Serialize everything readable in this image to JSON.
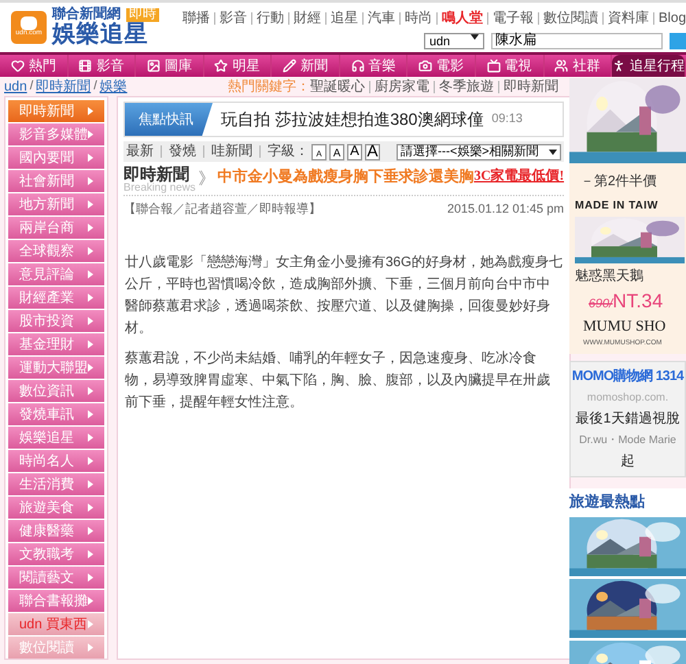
{
  "header": {
    "brand_small": "聯合新聞網",
    "brand_badge": "即時",
    "brand_name": "娛樂追星",
    "logo_caption": "udn.com",
    "top_links": [
      {
        "label": "聯播",
        "highlight": false
      },
      {
        "label": "影音",
        "highlight": false
      },
      {
        "label": "行動",
        "highlight": false
      },
      {
        "label": "財經",
        "highlight": false
      },
      {
        "label": "追星",
        "highlight": false
      },
      {
        "label": "汽車",
        "highlight": false
      },
      {
        "label": "時尚",
        "highlight": false
      },
      {
        "label": "鳴人堂",
        "highlight": true
      },
      {
        "label": "電子報",
        "highlight": false
      },
      {
        "label": "數位閱讀",
        "highlight": false
      },
      {
        "label": "資料庫",
        "highlight": false
      },
      {
        "label": "Blog",
        "highlight": false
      }
    ],
    "search": {
      "scope": "udn",
      "value": "陳水扁"
    }
  },
  "nav": [
    {
      "label": "熱門",
      "selected": false
    },
    {
      "label": "影音",
      "selected": false
    },
    {
      "label": "圖庫",
      "selected": false
    },
    {
      "label": "明星",
      "selected": false
    },
    {
      "label": "新聞",
      "selected": false
    },
    {
      "label": "音樂",
      "selected": false
    },
    {
      "label": "電影",
      "selected": false
    },
    {
      "label": "電視",
      "selected": false
    },
    {
      "label": "社群",
      "selected": false
    },
    {
      "label": "追星行程",
      "selected": true
    }
  ],
  "breadcrumb": [
    {
      "kind": "link",
      "text": "udn"
    },
    {
      "kind": "sep",
      "text": "/"
    },
    {
      "kind": "link",
      "text": "即時新聞"
    },
    {
      "kind": "sep",
      "text": "/"
    },
    {
      "kind": "link",
      "text": "娛樂"
    }
  ],
  "hot_keywords": {
    "label": "熱門關鍵字：",
    "items": [
      "聖誕暖心",
      "廚房家電",
      "冬季旅遊",
      "即時新聞"
    ]
  },
  "sidebar": [
    {
      "label": "即時新聞",
      "kind": "normal",
      "selected": true
    },
    {
      "label": "影音多媒體",
      "kind": "normal",
      "selected": false
    },
    {
      "label": "國內要聞",
      "kind": "normal",
      "selected": false
    },
    {
      "label": "社會新聞",
      "kind": "normal",
      "selected": false
    },
    {
      "label": "地方新聞",
      "kind": "normal",
      "selected": false
    },
    {
      "label": "兩岸台商",
      "kind": "normal",
      "selected": false
    },
    {
      "label": "全球觀察",
      "kind": "normal",
      "selected": false
    },
    {
      "label": "意見評論",
      "kind": "normal",
      "selected": false
    },
    {
      "label": "財經產業",
      "kind": "normal",
      "selected": false
    },
    {
      "label": "股市投資",
      "kind": "normal",
      "selected": false
    },
    {
      "label": "基金理財",
      "kind": "normal",
      "selected": false
    },
    {
      "label": "運動大聯盟",
      "kind": "normal",
      "selected": false
    },
    {
      "label": "數位資訊",
      "kind": "normal",
      "selected": false
    },
    {
      "label": "發燒車訊",
      "kind": "normal",
      "selected": false
    },
    {
      "label": "娛樂追星",
      "kind": "normal",
      "selected": false
    },
    {
      "label": "時尚名人",
      "kind": "normal",
      "selected": false
    },
    {
      "label": "生活消費",
      "kind": "normal",
      "selected": false
    },
    {
      "label": "旅遊美食",
      "kind": "normal",
      "selected": false
    },
    {
      "label": "健康醫藥",
      "kind": "normal",
      "selected": false
    },
    {
      "label": "文教職考",
      "kind": "normal",
      "selected": false
    },
    {
      "label": "閱讀藝文",
      "kind": "normal",
      "selected": false
    },
    {
      "label": "聯合書報攤",
      "kind": "normal",
      "selected": false
    },
    {
      "label": "udn 買東西",
      "kind": "shop",
      "selected": false
    },
    {
      "label": "數位閱讀",
      "kind": "shop",
      "selected": false
    }
  ],
  "focus": {
    "tag": "焦點快訊",
    "headline": "玩自拍 莎拉波娃想拍進380澳網球僮",
    "time": "09:13"
  },
  "toolbar": {
    "links": [
      "最新",
      "發燒",
      "哇新聞"
    ],
    "font_label": "字級：",
    "font_sizes": [
      {
        "label": "A",
        "selected": false
      },
      {
        "label": "A",
        "selected": false
      },
      {
        "label": "A",
        "selected": false
      },
      {
        "label": "A",
        "selected": false
      }
    ],
    "related": "請選擇---<娛樂>相關新聞"
  },
  "article": {
    "section": "即時新聞",
    "section_en": "Breaking news",
    "separator": "》",
    "title": "中市金小曼為戲瘦身胸下垂求診還美胸",
    "promo": "3C家電最低價!",
    "byline": "【聯合報／記者趙容萱／即時報導】",
    "date": "2015.01.12 01:45 pm",
    "paragraphs": [
      "廿八歲電影「戀戀海灣」女主角金小曼擁有36G的好身材，她為戲瘦身七公斤，平時也習慣喝冷飲，造成胸部外擴、下垂，三個月前向台中市中醫師蔡蕙君求診，透過喝茶飲、按壓穴道、以及健胸操，回復曼妙好身材。",
      "蔡蕙君說，不少尚未結婚、哺乳的年輕女子，因急速瘦身、吃冰冷食物，易導致脾胃虛寒、中氣下陷，胸、臉、腹部，以及內臟提早在卅歲前下垂，提醒年輕女性注意。"
    ]
  },
  "ad": {
    "offer": "－第2件半價",
    "made_in": "MADE IN TAIW",
    "product": "魅惑黑天鵝",
    "old_price": "690/",
    "price": "NT.34",
    "brand": "MUMU SHO",
    "site": "WWW.MUMUSHOP.COM"
  },
  "momo": {
    "title": "MOMO購物網 1314",
    "domain": "momoshop.com.",
    "line": "最後1天錯過視脫",
    "brands": "Dr.wu・Mode Marie",
    "tail": "起"
  },
  "travel": {
    "title": "旅遊最熱點"
  }
}
